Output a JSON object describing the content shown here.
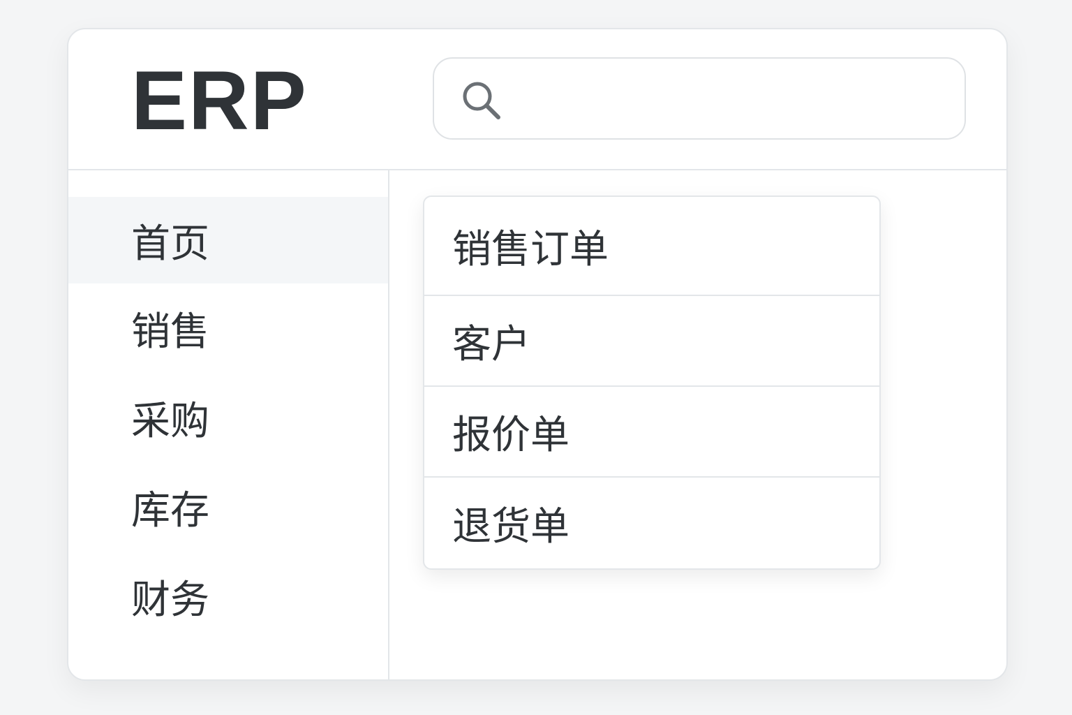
{
  "app": {
    "logo": "ERP"
  },
  "search": {
    "icon": "search-icon",
    "placeholder": "",
    "value": ""
  },
  "sidebar": {
    "active_index": 0,
    "items": [
      {
        "label": "首页"
      },
      {
        "label": "销售"
      },
      {
        "label": "采购"
      },
      {
        "label": "库存"
      },
      {
        "label": "财务"
      }
    ]
  },
  "submenu": {
    "items": [
      {
        "label": "销售订单"
      },
      {
        "label": "客户"
      },
      {
        "label": "报价单"
      },
      {
        "label": "退货单"
      }
    ]
  },
  "colors": {
    "background": "#f4f5f6",
    "text": "#2f3337",
    "border": "#e3e6e9",
    "active_item": "#f4f6f8",
    "icon": "#6b7075"
  }
}
